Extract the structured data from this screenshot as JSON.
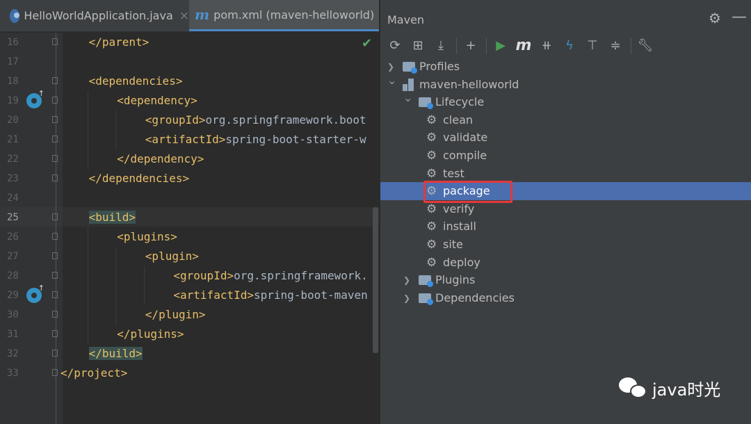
{
  "editor": {
    "tabs": [
      {
        "label": "HelloWorldApplication.java",
        "close": "×"
      },
      {
        "label": "pom.xml (maven-helloworld)",
        "close": "×"
      }
    ],
    "check": "✔",
    "lines": [
      {
        "num": "16",
        "indent": 1,
        "parts": [
          {
            "t": "</parent>",
            "c": "tag"
          }
        ]
      },
      {
        "num": "17",
        "indent": 0,
        "parts": []
      },
      {
        "num": "18",
        "indent": 1,
        "parts": [
          {
            "t": "<dependencies>",
            "c": "tag"
          }
        ]
      },
      {
        "num": "19",
        "indent": 2,
        "parts": [
          {
            "t": "<dependency>",
            "c": "tag"
          }
        ],
        "gicon": true
      },
      {
        "num": "20",
        "indent": 3,
        "parts": [
          {
            "t": "<groupId>",
            "c": "tag"
          },
          {
            "t": "org.springframework.boot",
            "c": "txt"
          }
        ]
      },
      {
        "num": "21",
        "indent": 3,
        "parts": [
          {
            "t": "<artifactId>",
            "c": "tag"
          },
          {
            "t": "spring-boot-starter-w",
            "c": "txt"
          }
        ]
      },
      {
        "num": "22",
        "indent": 2,
        "parts": [
          {
            "t": "</dependency>",
            "c": "tag"
          }
        ]
      },
      {
        "num": "23",
        "indent": 1,
        "parts": [
          {
            "t": "</dependencies>",
            "c": "tag"
          }
        ]
      },
      {
        "num": "24",
        "indent": 0,
        "parts": []
      },
      {
        "num": "25",
        "indent": 1,
        "parts": [
          {
            "t": "<build>",
            "c": "tag hl"
          }
        ],
        "current": true
      },
      {
        "num": "26",
        "indent": 2,
        "parts": [
          {
            "t": "<plugins>",
            "c": "tag"
          }
        ]
      },
      {
        "num": "27",
        "indent": 3,
        "parts": [
          {
            "t": "<plugin>",
            "c": "tag"
          }
        ]
      },
      {
        "num": "28",
        "indent": 4,
        "parts": [
          {
            "t": "<groupId>",
            "c": "tag"
          },
          {
            "t": "org.springframework.",
            "c": "txt"
          }
        ]
      },
      {
        "num": "29",
        "indent": 4,
        "parts": [
          {
            "t": "<artifactId>",
            "c": "tag"
          },
          {
            "t": "spring-boot-maven",
            "c": "txt"
          }
        ],
        "gicon": true
      },
      {
        "num": "30",
        "indent": 3,
        "parts": [
          {
            "t": "</plugin>",
            "c": "tag"
          }
        ]
      },
      {
        "num": "31",
        "indent": 2,
        "parts": [
          {
            "t": "</plugins>",
            "c": "tag"
          }
        ]
      },
      {
        "num": "32",
        "indent": 1,
        "parts": [
          {
            "t": "</build>",
            "c": "tag hl"
          }
        ]
      },
      {
        "num": "33",
        "indent": 0,
        "parts": [
          {
            "t": "</project>",
            "c": "tag"
          }
        ]
      }
    ]
  },
  "maven": {
    "title": "Maven",
    "gear": "⚙",
    "minimize": "—",
    "toolbar": [
      {
        "name": "reload-icon",
        "g": "⟳",
        "color": "#afb1b3"
      },
      {
        "name": "generate-sources-icon",
        "g": "⊞",
        "color": "#afb1b3"
      },
      {
        "name": "download-icon",
        "g": "⤓",
        "color": "#afb1b3"
      },
      {
        "sep": true
      },
      {
        "name": "add-icon",
        "g": "+",
        "color": "#afb1b3"
      },
      {
        "sep": true
      },
      {
        "name": "run-icon",
        "g": "▶",
        "color": "#499c54"
      },
      {
        "name": "execute-goal-icon",
        "g": "m",
        "color": "#dddddd"
      },
      {
        "name": "toggle-offline-icon",
        "g": "⧺",
        "color": "#afb1b3"
      },
      {
        "name": "skip-tests-icon",
        "g": "ϟ",
        "color": "#3592c4"
      },
      {
        "name": "show-dependencies-icon",
        "g": "⊤",
        "color": "#afb1b3"
      },
      {
        "name": "collapse-all-icon",
        "g": "≑",
        "color": "#afb1b3"
      },
      {
        "sep": true
      },
      {
        "name": "settings-wrench-icon",
        "g": "🔧︎",
        "color": "#afb1b3"
      }
    ],
    "tree": [
      {
        "label": "Profiles",
        "level": 0,
        "arrow": "›",
        "icon": "folder"
      },
      {
        "label": "maven-helloworld",
        "level": 0,
        "arrow": "⌄",
        "icon": "module"
      },
      {
        "label": "Lifecycle",
        "level": 1,
        "arrow": "⌄",
        "icon": "folder"
      },
      {
        "label": "clean",
        "level": 2,
        "icon": "gear"
      },
      {
        "label": "validate",
        "level": 2,
        "icon": "gear"
      },
      {
        "label": "compile",
        "level": 2,
        "icon": "gear"
      },
      {
        "label": "test",
        "level": 2,
        "icon": "gear"
      },
      {
        "label": "package",
        "level": 2,
        "icon": "gear",
        "selected": true
      },
      {
        "label": "verify",
        "level": 2,
        "icon": "gear"
      },
      {
        "label": "install",
        "level": 2,
        "icon": "gear"
      },
      {
        "label": "site",
        "level": 2,
        "icon": "gear"
      },
      {
        "label": "deploy",
        "level": 2,
        "icon": "gear"
      },
      {
        "label": "Plugins",
        "level": 1,
        "arrow": "›",
        "icon": "folder"
      },
      {
        "label": "Dependencies",
        "level": 1,
        "arrow": "›",
        "icon": "folder"
      }
    ]
  },
  "watermark": {
    "text": "java时光"
  }
}
